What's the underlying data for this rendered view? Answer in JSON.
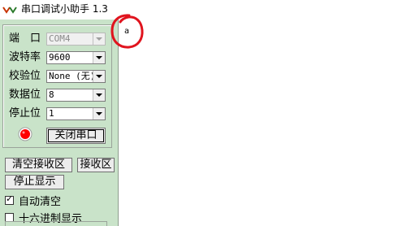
{
  "window": {
    "title": "串口调试小助手 1.3"
  },
  "port_settings": [
    {
      "label": "端　口",
      "value": "COM4",
      "disabled": true
    },
    {
      "label": "波特率",
      "value": "9600"
    },
    {
      "label": "校验位",
      "value": "None (无)"
    },
    {
      "label": "数据位",
      "value": "8"
    },
    {
      "label": "停止位",
      "value": "1"
    }
  ],
  "controls": {
    "close_port_label": "关闭串口",
    "clear_receive_label": "清空接收区",
    "receive_area_label": "接收区",
    "stop_display_label": "停止显示",
    "auto_clear_label": "自动清空",
    "auto_clear_checked": true,
    "hex_display_label": "十六进制显示",
    "hex_display_checked": false
  },
  "receive": {
    "text": "a"
  },
  "colors": {
    "panel_bg": "#c9e3c9",
    "led": "#ff0000",
    "annotation": "#e0141e"
  },
  "icons": {
    "app": "serial-app-icon",
    "status": "port-status-led-icon"
  }
}
